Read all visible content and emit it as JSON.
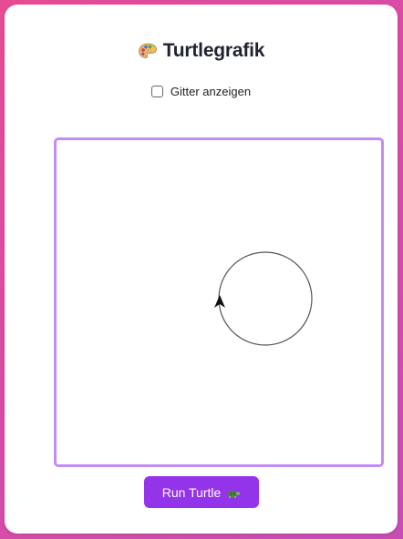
{
  "header": {
    "title": "Turtlegrafik",
    "title_icon": "artist-palette-icon"
  },
  "grid_toggle": {
    "label": "Gitter anzeigen",
    "checked": false
  },
  "canvas": {
    "border_color": "#c28cf5",
    "shapes": [
      {
        "type": "circle",
        "stroke": "#555555"
      }
    ],
    "turtle": {
      "icon": "arrow-cursor-icon",
      "heading": "up",
      "color": "#111111"
    }
  },
  "run_button": {
    "label": "Run Turtle",
    "icon": "turtle-icon",
    "color": "#9333ea"
  },
  "colors": {
    "background_gradient_start": "#e84a93",
    "background_gradient_end": "#c74db4",
    "card": "#ffffff"
  }
}
